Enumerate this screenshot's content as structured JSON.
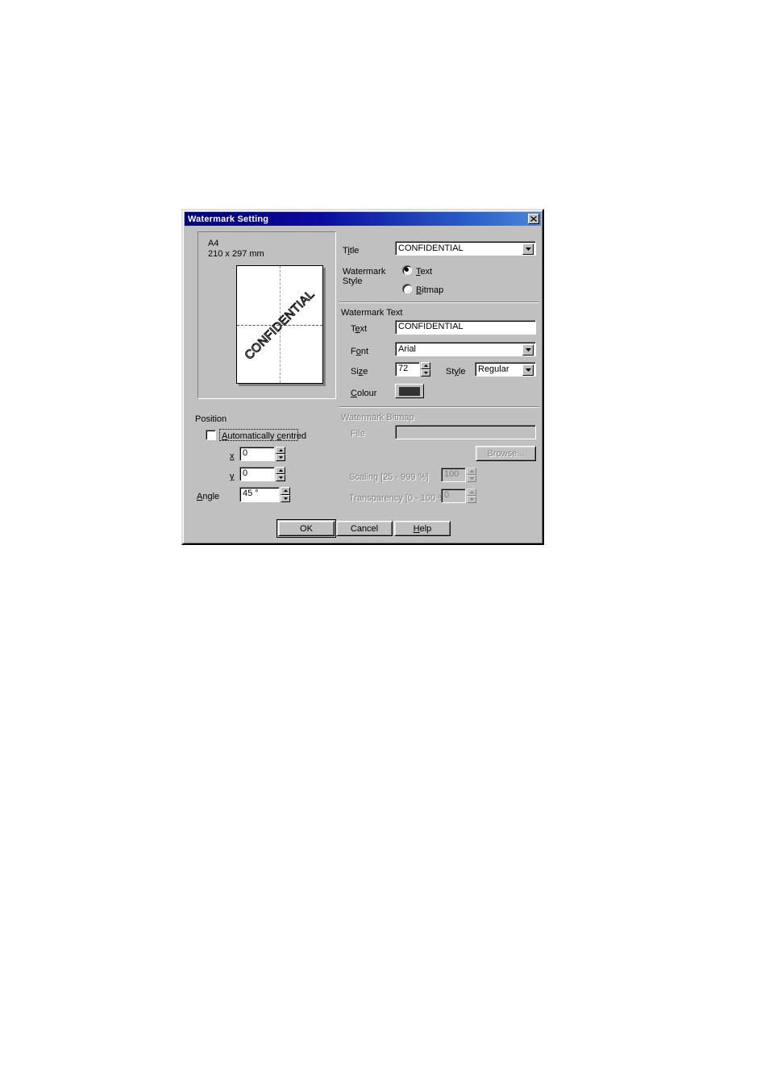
{
  "window": {
    "title": "Watermark Setting",
    "close_label": "close-icon"
  },
  "preview": {
    "paper_name": "A4",
    "paper_dims": "210 x 297 mm",
    "watermark_text": "CONFIDENTIAL"
  },
  "title_row": {
    "label": "Title",
    "value": "CONFIDENTIAL"
  },
  "watermark_style": {
    "label_line1": "Watermark",
    "label_line2": "Style",
    "options": [
      {
        "label": "Text",
        "accel": "T",
        "selected": true
      },
      {
        "label": "Bitmap",
        "accel": "B",
        "selected": false
      }
    ]
  },
  "watermark_text_group": {
    "legend": "Watermark Text",
    "text_label": "Text",
    "text_value": "CONFIDENTIAL",
    "font_label": "Font",
    "font_value": "Arial",
    "size_label": "Size",
    "size_value": "72",
    "style_label": "Style",
    "style_value": "Regular",
    "colour_label": "Colour",
    "colour_value": "#333333"
  },
  "watermark_bitmap_group": {
    "legend": "Watermark Bitmap",
    "file_label": "File",
    "file_value": "",
    "browse_label": "Browse...",
    "scaling_label": "Scaling [25 - 999 %]",
    "scaling_value": "100",
    "transparency_label": "Transparency [0 - 100 %]",
    "transparency_value": "0",
    "enabled": false
  },
  "position_group": {
    "legend": "Position",
    "auto_centred_label": "Automatically centred",
    "auto_centred_checked": false,
    "x_label": "x",
    "x_value": "0",
    "y_label": "y",
    "y_value": "0",
    "angle_label": "Angle",
    "angle_value": "45 °"
  },
  "buttons": {
    "ok": "OK",
    "cancel": "Cancel",
    "help": "Help"
  }
}
